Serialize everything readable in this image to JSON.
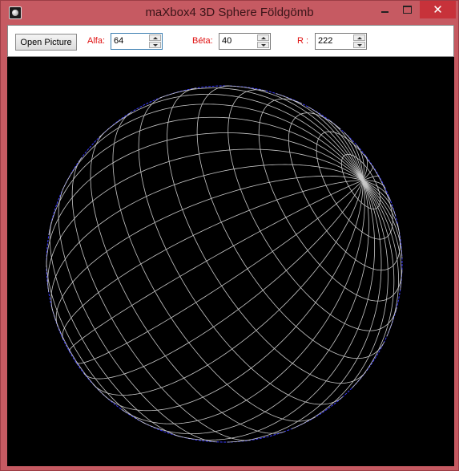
{
  "window": {
    "title": "maXbox4 3D Sphere Földgömb",
    "close_glyph": "✕"
  },
  "toolbar": {
    "open_button_label": "Open Picture",
    "alfa_label": "Alfa:",
    "alfa_value": "64",
    "beta_label": "Béta:",
    "beta_value": "40",
    "r_label": "R :",
    "r_value": "222"
  },
  "sphere": {
    "alfa_deg": 64,
    "beta_deg": 40,
    "radius": 222,
    "meridian_step_deg": 10,
    "parallel_step_deg": 10,
    "grid_color": "#c8c8c8",
    "outline_color": "#3a3aff",
    "background_color": "#000000"
  },
  "icons": {
    "app": "globe-app-icon",
    "minimize": "minimize-icon",
    "maximize": "maximize-icon",
    "close": "close-icon"
  }
}
